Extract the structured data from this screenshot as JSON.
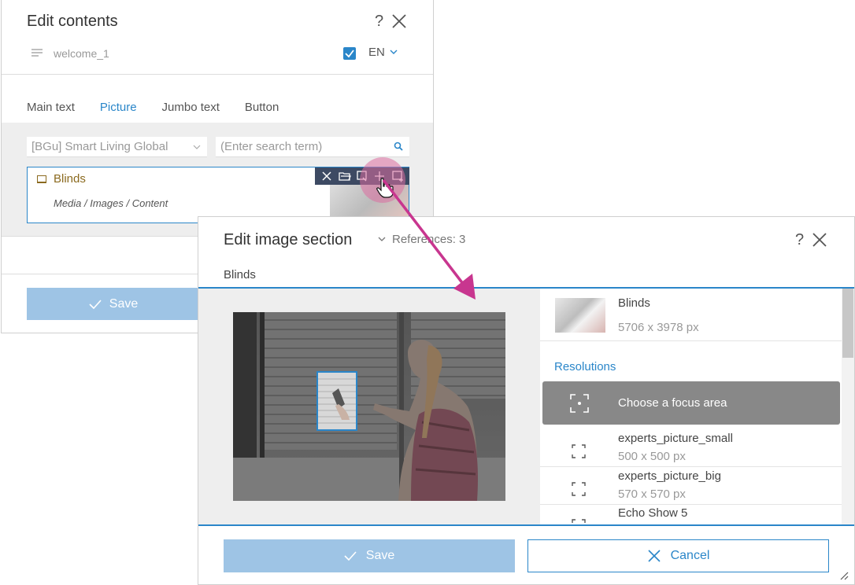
{
  "back_dialog": {
    "title": "Edit contents",
    "help": "?",
    "content_name": "welcome_1",
    "language": "EN",
    "tabs": [
      "Main text",
      "Picture",
      "Jumbo text",
      "Button"
    ],
    "active_tab": "Picture",
    "select_value": "[BGu] Smart Living Global",
    "search_placeholder": "(Enter search term)",
    "media_item": {
      "name": "Blinds",
      "path": "Media / Images / Content"
    },
    "save_label": "Save"
  },
  "front_dialog": {
    "title": "Edit image section",
    "references": "References: 3",
    "help": "?",
    "subtitle": "Blinds",
    "image": {
      "name": "Blinds",
      "dimensions": "5706 x 3978 px"
    },
    "resolutions_label": "Resolutions",
    "focus_button": "Choose a focus area",
    "resolutions": [
      {
        "name": "experts_picture_small",
        "dims": "500 x 500 px"
      },
      {
        "name": "experts_picture_big",
        "dims": "570 x 570 px"
      },
      {
        "name": "Echo Show 5",
        "dims": ""
      }
    ],
    "save_label": "Save",
    "cancel_label": "Cancel"
  },
  "colors": {
    "accent": "#2a86c9",
    "save_disabled": "#9ec4e5",
    "arrow": "#c8368f",
    "toolbar": "#3d4a63",
    "focus_button": "#888888"
  }
}
